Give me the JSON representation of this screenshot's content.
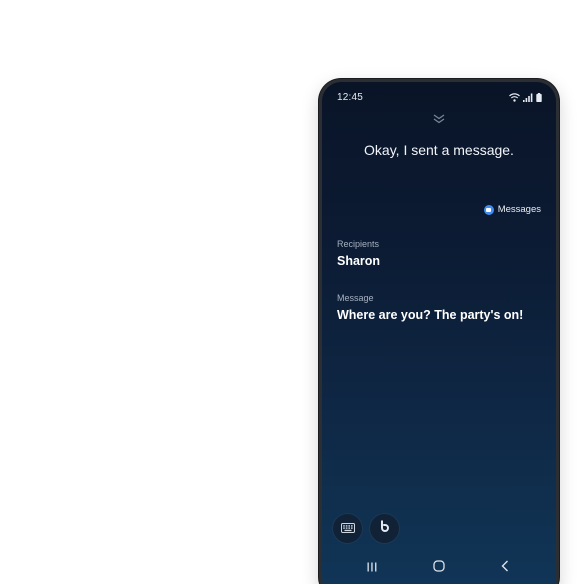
{
  "status_bar": {
    "time": "12:45",
    "icons": [
      "wifi-icon",
      "signal-icon",
      "battery-icon"
    ]
  },
  "assistant": {
    "response": "Okay, I sent a message.",
    "app_chip": {
      "label": "Messages",
      "icon": "messages-app-icon",
      "color": "#3f8df2"
    }
  },
  "fields": {
    "recipients_label": "Recipients",
    "recipients_value": "Sharon",
    "message_label": "Message",
    "message_value": "Where are you? The party's on!"
  },
  "input_buttons": [
    "keyboard-icon",
    "bixby-icon"
  ],
  "nav_bar": [
    "recents-icon",
    "home-icon",
    "back-icon"
  ],
  "colors": {
    "background_top": "#0a1427",
    "background_bottom": "#113658",
    "label": "#a6b0bf"
  }
}
